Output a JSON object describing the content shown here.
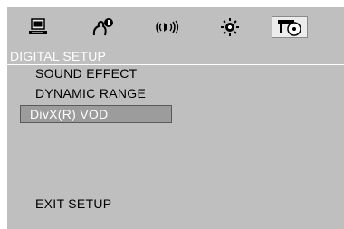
{
  "tabs": [
    {
      "icon": "computer-icon",
      "selected": false
    },
    {
      "icon": "speaker-person-icon",
      "selected": false
    },
    {
      "icon": "sound-waves-icon",
      "selected": false
    },
    {
      "icon": "sun-brightness-icon",
      "selected": false
    },
    {
      "icon": "disc-setup-icon",
      "selected": true
    }
  ],
  "menu": {
    "header": "DIGITAL SETUP",
    "items": [
      {
        "label": "SOUND EFFECT",
        "highlighted": false
      },
      {
        "label": "DYNAMIC RANGE",
        "highlighted": false
      },
      {
        "label": "DivX(R) VOD",
        "highlighted": true
      }
    ],
    "exit_label": "EXIT SETUP"
  },
  "colors": {
    "background": "#bfbfbf",
    "header_text": "#ffffff",
    "highlight": "#9c9c9c"
  }
}
